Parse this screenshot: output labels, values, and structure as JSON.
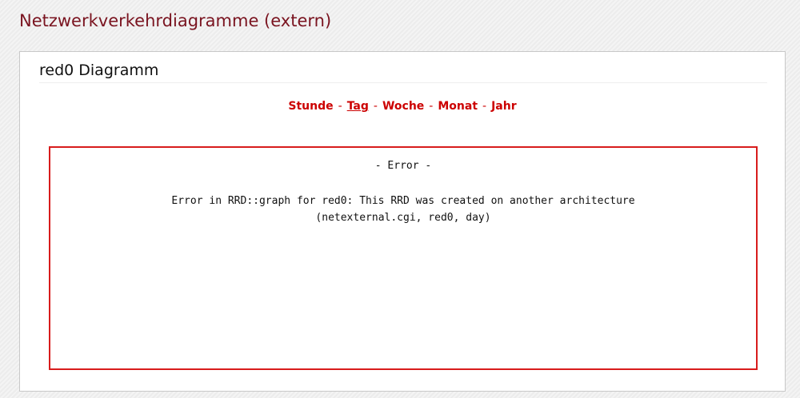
{
  "page": {
    "title": "Netzwerkverkehrdiagramme (extern)"
  },
  "panel": {
    "title": "red0 Diagramm"
  },
  "range_nav": {
    "items": [
      {
        "label": "Stunde",
        "active": false
      },
      {
        "label": "Tag",
        "active": true
      },
      {
        "label": "Woche",
        "active": false
      },
      {
        "label": "Monat",
        "active": false
      },
      {
        "label": "Jahr",
        "active": false
      }
    ],
    "separator": "-"
  },
  "graph": {
    "error_heading": "- Error -",
    "error_line_1": "Error in RRD::graph for red0: This RRD was created on another architecture",
    "error_line_2": "(netexternal.cgi, red0, day)"
  },
  "colors": {
    "title": "#7a1420",
    "link": "#cc0000",
    "error_border": "#d81c1c"
  }
}
